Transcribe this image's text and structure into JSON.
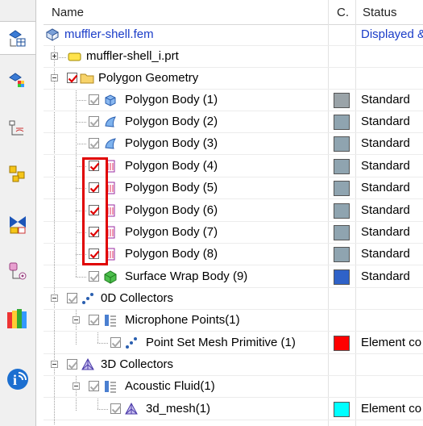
{
  "header": {
    "name": "Name",
    "c": "C.",
    "status": "Status"
  },
  "sidebar": [
    "simulation-navigator-icon",
    "simulation-file-view-icon",
    "roles-icon",
    "part-navigator-icon",
    "constraints-icon",
    "assembly-navigator-icon",
    "history-icon",
    "help-icon"
  ],
  "rows": [
    {
      "label": "muffler-shell.fem",
      "status": "Displayed &",
      "link": true
    },
    {
      "label": "muffler-shell_i.prt"
    },
    {
      "label": "Polygon Geometry"
    },
    {
      "label": "Polygon Body (1)",
      "status": "Standard",
      "color": "#9aa3a8"
    },
    {
      "label": "Polygon Body (2)",
      "status": "Standard",
      "color": "#8fa4b0"
    },
    {
      "label": "Polygon Body (3)",
      "status": "Standard",
      "color": "#8fa4b0"
    },
    {
      "label": "Polygon Body (4)",
      "status": "Standard",
      "color": "#8fa4b0"
    },
    {
      "label": "Polygon Body (5)",
      "status": "Standard",
      "color": "#8fa4b0"
    },
    {
      "label": "Polygon Body (6)",
      "status": "Standard",
      "color": "#8fa4b0"
    },
    {
      "label": "Polygon Body (7)",
      "status": "Standard",
      "color": "#8fa4b0"
    },
    {
      "label": "Polygon Body (8)",
      "status": "Standard",
      "color": "#8fa4b0"
    },
    {
      "label": "Surface Wrap Body (9)",
      "status": "Standard",
      "color": "#2f62c8"
    },
    {
      "label": "0D Collectors"
    },
    {
      "label": "Microphone Points(1)"
    },
    {
      "label": "Point Set Mesh Primitive (1)",
      "status": "Element co",
      "color": "#ff0000"
    },
    {
      "label": "3D Collectors"
    },
    {
      "label": "Acoustic Fluid(1)"
    },
    {
      "label": "3d_mesh(1)",
      "status": "Element co",
      "color": "#00ffff"
    }
  ]
}
